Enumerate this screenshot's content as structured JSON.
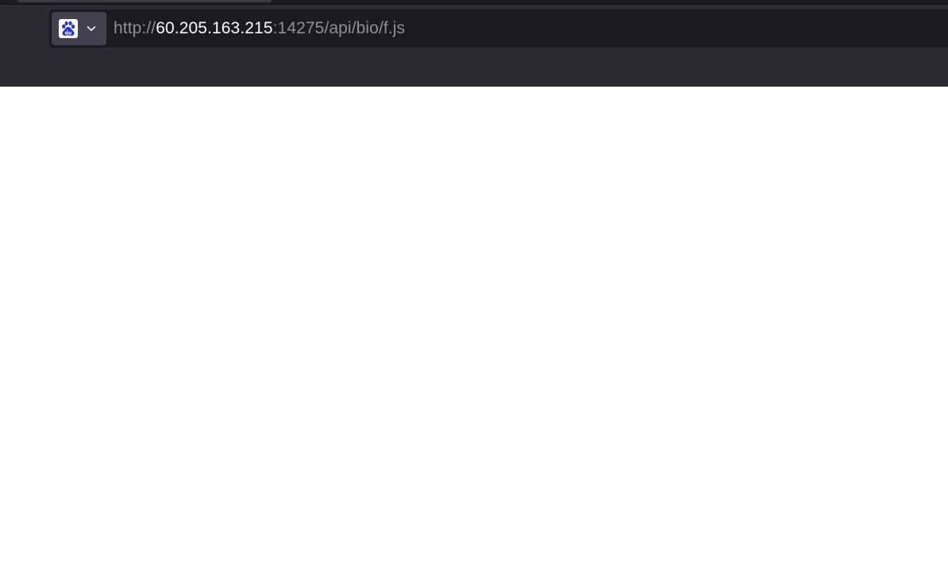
{
  "urlbar": {
    "search_engine": {
      "icon": "baidu-logo-icon",
      "dropdown_icon": "chevron-down-icon"
    },
    "url": {
      "scheme": "http://",
      "host": "60.205.163.215",
      "rest": ":14275/api/bio/f.js"
    }
  },
  "colors": {
    "chrome_background": "#2b2a33",
    "urlbar_background": "#1c1b22",
    "engine_button_background": "#42414d",
    "url_host": "#fbfbfe",
    "url_dim": "#8f8f9d",
    "baidu_blue": "#2932e1",
    "page_background": "#ffffff"
  }
}
